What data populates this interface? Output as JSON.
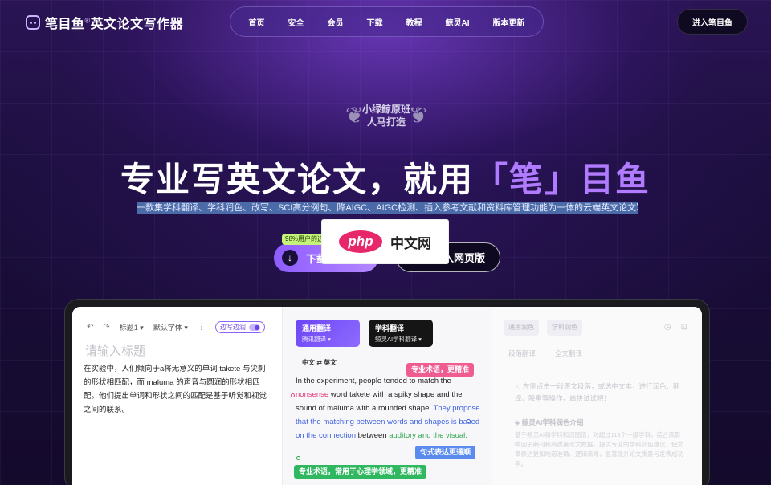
{
  "header": {
    "logo_text": "笔目鱼",
    "logo_sup": "®",
    "logo_subtitle": "英文论文写作器",
    "nav": [
      "首页",
      "安全",
      "会员",
      "下载",
      "教程",
      "鲸灵AI",
      "版本更新"
    ],
    "cta": "进入笔目鱼"
  },
  "hero": {
    "badge_line1": "小绿鲸原班",
    "badge_line2": "人马打造",
    "headline_pre": "专业写英文论文，就用",
    "headline_brand": "「笔」",
    "headline_post": "目鱼",
    "subline": "一款集学科翻译、学科润色、改写、SCI高分例句、降AIGC、AIGC检测、插入参考文献和资料库管理功能为一体的云端英文论文写作器",
    "download_tag": "98%用户的选",
    "download_label": "下载",
    "web_label": "入网页版",
    "overlay_php": "php",
    "overlay_cn": "中文网"
  },
  "editor": {
    "toolbar": {
      "undo_icon": "undo-icon",
      "redo_icon": "redo-icon",
      "heading_select": "标题1",
      "font_select": "默认字体",
      "toggle_label": "边写边润"
    },
    "title_placeholder": "请输入标题",
    "body": "在实验中，人们倾向于a将无意义的单词 takete 与尖刺的形状相匹配，而 maluma 的声音与圆润的形状相匹配。他们提出单词和形状之间的匹配是基于听觉和视觉之间的联系。"
  },
  "translate": {
    "card_general_title": "通用翻译",
    "card_general_sub": "腾讯翻译",
    "card_subject_title": "学科翻译",
    "card_subject_sub": "鲸灵AI学科翻译",
    "lang_from": "中文",
    "lang_to": "英文",
    "body_1": "In the experiment, people tended to match the ",
    "body_pink": "nonsense",
    "body_2": " word takete with a spiky shape and the sound of maluma with a rounded shape. ",
    "body_blue": "They propose that the matching between words and shapes is based on the connection",
    "body_3": " between ",
    "body_green": "auditory and the visual.",
    "tag_pink": "专业术语，更精准",
    "tag_blue": "句式表达更通顺",
    "tag_green": "专业术语，常用于心理学领域，更精准"
  },
  "right_panel": {
    "tabs": [
      "通用润色",
      "学科润色"
    ],
    "subtabs": [
      "段落翻译",
      "全文翻译"
    ],
    "hint": "左侧点击一段原文段落，或选中文本，进行润色、翻译、降重等操作，启快试试吧！",
    "section_title": "鲸灵AI学科润色介绍",
    "section_desc": "基于鲸灵AI和学科知识图谱，对超过113个一级学科，结合高影响因子期刊和高质量论文数据，提供专业的学科润色建议，使文章表达更加地道准确、逻辑清晰，显著提升论文质量与发表成功率。"
  },
  "colors": {
    "accent": "#8e5cff",
    "brand_highlight": "#b07bff",
    "tag_pink": "#ee5c92",
    "tag_blue": "#5a8cf0",
    "tag_green": "#30b860"
  }
}
